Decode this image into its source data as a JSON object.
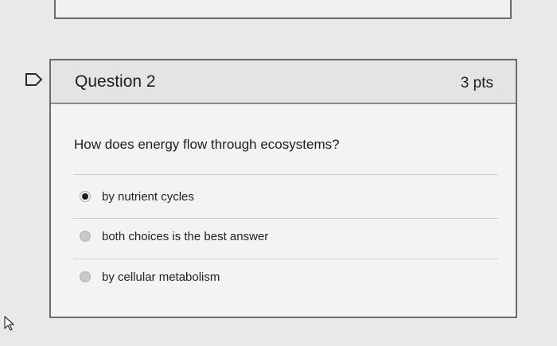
{
  "question": {
    "title": "Question 2",
    "points": "3 pts",
    "text": "How does energy flow through ecosystems?",
    "answers": [
      {
        "label": "by nutrient cycles",
        "selected": true
      },
      {
        "label": "both choices is the best answer",
        "selected": false
      },
      {
        "label": "by cellular metabolism",
        "selected": false
      }
    ]
  },
  "icons": {
    "flag": "flag-icon",
    "cursor": "mouse-pointer-icon"
  }
}
